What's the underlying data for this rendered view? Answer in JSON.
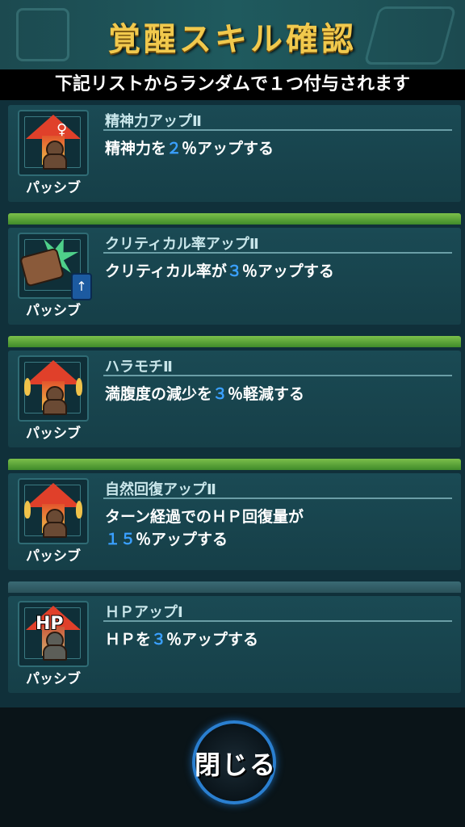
{
  "header": {
    "title": "覚醒スキル確認",
    "subtitle": "下記リストからランダムで１つ付与されます"
  },
  "skills": [
    {
      "name": "精神力アップⅡ",
      "type_label": "パッシブ",
      "desc_pre": "精神力を",
      "desc_num": "２",
      "desc_post": "％アップする",
      "icon": "spirit-up-icon"
    },
    {
      "name": "クリティカル率アップⅡ",
      "type_label": "パッシブ",
      "desc_pre": "クリティカル率が",
      "desc_num": "３",
      "desc_post": "％アップする",
      "icon": "critical-up-icon"
    },
    {
      "name": "ハラモチⅡ",
      "type_label": "パッシブ",
      "desc_pre": "満腹度の減少を",
      "desc_num": "３",
      "desc_post": "％軽減する",
      "icon": "satiety-icon"
    },
    {
      "name": "自然回復アップⅡ",
      "type_label": "パッシブ",
      "desc_pre": "ターン経過でのＨＰ回復量が",
      "desc_num": "１５",
      "desc_post": "％アップする",
      "icon": "natural-recovery-icon"
    },
    {
      "name": "ＨＰアップⅠ",
      "type_label": "パッシブ",
      "desc_pre": "ＨＰを",
      "desc_num": "３",
      "desc_post": "％アップする",
      "icon": "hp-up-icon",
      "icon_text": "HP"
    }
  ],
  "footer": {
    "close_label": "閉じる"
  }
}
